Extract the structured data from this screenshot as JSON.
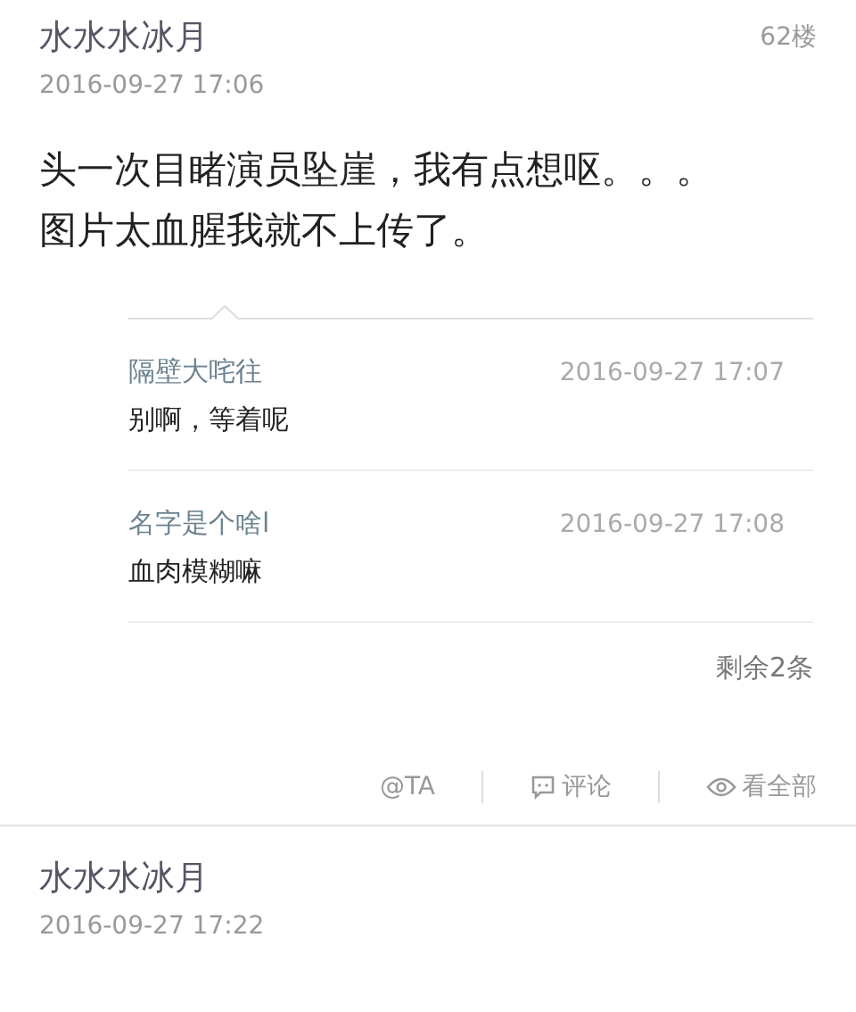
{
  "posts": [
    {
      "author": "水水水冰月",
      "time": "2016-09-27 17:06",
      "floor": "62楼",
      "body": [
        "头一次目睹演员坠崖，我有点想呕。。。",
        "图片太血腥我就不上传了。"
      ],
      "replies": [
        {
          "author": "隔壁大咤往",
          "time": "2016-09-27 17:07",
          "text": "别啊，等着呢"
        },
        {
          "author": "名字是个啥l",
          "time": "2016-09-27 17:08",
          "text": "血肉模糊嘛"
        }
      ],
      "more": "剩余2条",
      "actions": [
        {
          "kind": "mention",
          "label": "@TA"
        },
        {
          "kind": "comment",
          "label": "评论"
        },
        {
          "kind": "view",
          "label": "看全部"
        }
      ]
    },
    {
      "author": "水水水冰月",
      "time": "2016-09-27 17:22"
    }
  ]
}
